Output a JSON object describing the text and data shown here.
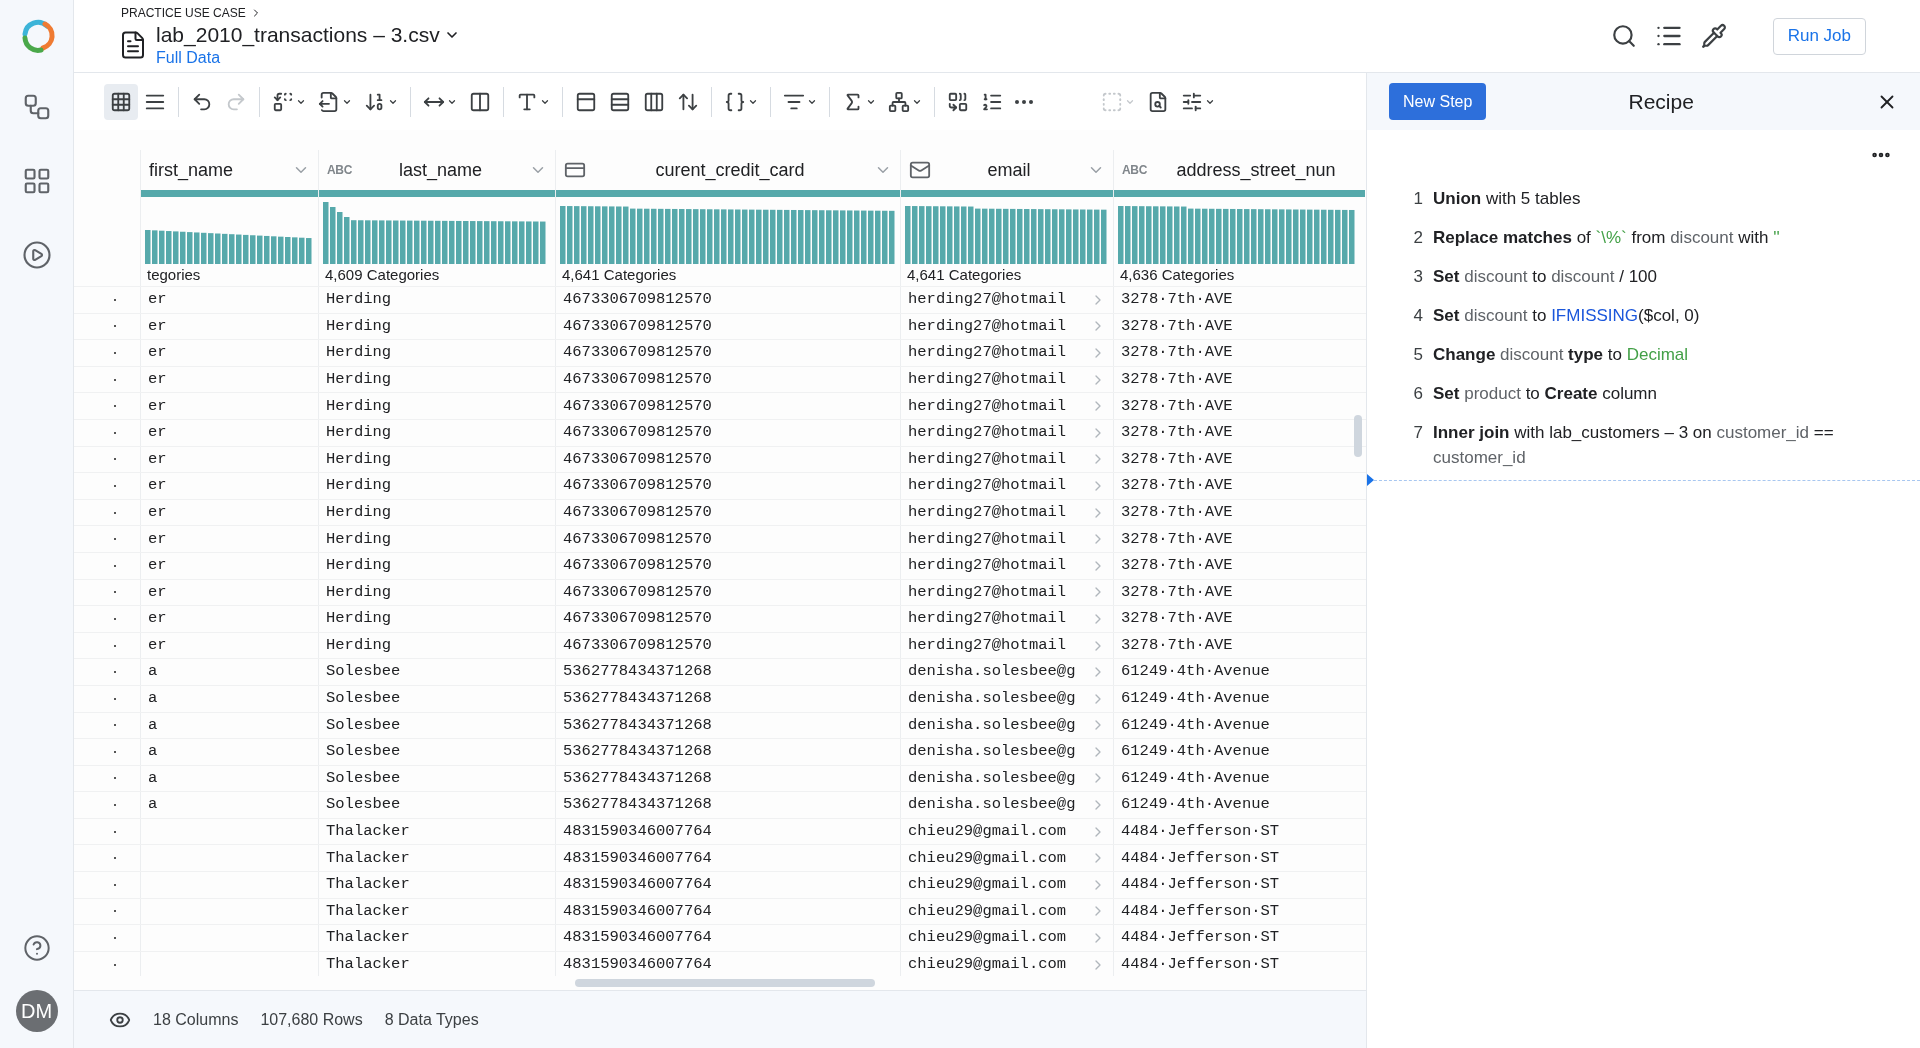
{
  "header": {
    "breadcrumb": "PRACTICE USE CASE",
    "title": "lab_2010_transactions – 3.csv",
    "subtitle": "Full Data",
    "run_button": "Run Job"
  },
  "toolbar": {
    "view_toggle": [
      {
        "selected": true
      },
      {
        "selected": false
      }
    ],
    "history": [
      {
        "disabled": false
      },
      {
        "disabled": true
      }
    ]
  },
  "columns": [
    {
      "name": "first_name",
      "kind": "none",
      "categories": "tegories",
      "level": 1,
      "dropdown": true
    },
    {
      "name": "last_name",
      "kind": "string",
      "type_label": "ABC",
      "categories": "4,609 Categories",
      "level": 1,
      "dropdown": true
    },
    {
      "name": "curent_credit_card",
      "kind": "card",
      "categories": "4,641 Categories",
      "level": 1,
      "dropdown": true
    },
    {
      "name": "email",
      "kind": "email",
      "categories": "4,641 Categories",
      "level": 1,
      "dropdown": true
    },
    {
      "name": "address_street_nun",
      "kind": "string",
      "type_label": "ABC",
      "categories": "4,636 Categories",
      "level": 1,
      "dropdown": false
    }
  ],
  "rows": [
    {
      "cells": [
        "er",
        "Herding",
        "4673306709812570",
        "herding27@hotmail",
        "3278·7th·AVE"
      ]
    },
    {
      "cells": [
        "er",
        "Herding",
        "4673306709812570",
        "herding27@hotmail",
        "3278·7th·AVE"
      ]
    },
    {
      "cells": [
        "er",
        "Herding",
        "4673306709812570",
        "herding27@hotmail",
        "3278·7th·AVE"
      ]
    },
    {
      "cells": [
        "er",
        "Herding",
        "4673306709812570",
        "herding27@hotmail",
        "3278·7th·AVE"
      ]
    },
    {
      "cells": [
        "er",
        "Herding",
        "4673306709812570",
        "herding27@hotmail",
        "3278·7th·AVE"
      ]
    },
    {
      "cells": [
        "er",
        "Herding",
        "4673306709812570",
        "herding27@hotmail",
        "3278·7th·AVE"
      ]
    },
    {
      "cells": [
        "er",
        "Herding",
        "4673306709812570",
        "herding27@hotmail",
        "3278·7th·AVE"
      ]
    },
    {
      "cells": [
        "er",
        "Herding",
        "4673306709812570",
        "herding27@hotmail",
        "3278·7th·AVE"
      ]
    },
    {
      "cells": [
        "er",
        "Herding",
        "4673306709812570",
        "herding27@hotmail",
        "3278·7th·AVE"
      ]
    },
    {
      "cells": [
        "er",
        "Herding",
        "4673306709812570",
        "herding27@hotmail",
        "3278·7th·AVE"
      ]
    },
    {
      "cells": [
        "er",
        "Herding",
        "4673306709812570",
        "herding27@hotmail",
        "3278·7th·AVE"
      ]
    },
    {
      "cells": [
        "er",
        "Herding",
        "4673306709812570",
        "herding27@hotmail",
        "3278·7th·AVE"
      ]
    },
    {
      "cells": [
        "er",
        "Herding",
        "4673306709812570",
        "herding27@hotmail",
        "3278·7th·AVE"
      ]
    },
    {
      "cells": [
        "er",
        "Herding",
        "4673306709812570",
        "herding27@hotmail",
        "3278·7th·AVE"
      ]
    },
    {
      "cells": [
        "a",
        "Solesbee",
        "5362778434371268",
        "denisha.solesbee@g",
        "61249·4th·Avenue"
      ]
    },
    {
      "cells": [
        "a",
        "Solesbee",
        "5362778434371268",
        "denisha.solesbee@g",
        "61249·4th·Avenue"
      ]
    },
    {
      "cells": [
        "a",
        "Solesbee",
        "5362778434371268",
        "denisha.solesbee@g",
        "61249·4th·Avenue"
      ]
    },
    {
      "cells": [
        "a",
        "Solesbee",
        "5362778434371268",
        "denisha.solesbee@g",
        "61249·4th·Avenue"
      ]
    },
    {
      "cells": [
        "a",
        "Solesbee",
        "5362778434371268",
        "denisha.solesbee@g",
        "61249·4th·Avenue"
      ]
    },
    {
      "cells": [
        "a",
        "Solesbee",
        "5362778434371268",
        "denisha.solesbee@g",
        "61249·4th·Avenue"
      ]
    },
    {
      "cells": [
        "",
        "Thalacker",
        "4831590346007764",
        "chieu29@gmail.com",
        "4484·Jefferson·ST"
      ]
    },
    {
      "cells": [
        "",
        "Thalacker",
        "4831590346007764",
        "chieu29@gmail.com",
        "4484·Jefferson·ST"
      ]
    },
    {
      "cells": [
        "",
        "Thalacker",
        "4831590346007764",
        "chieu29@gmail.com",
        "4484·Jefferson·ST"
      ]
    },
    {
      "cells": [
        "",
        "Thalacker",
        "4831590346007764",
        "chieu29@gmail.com",
        "4484·Jefferson·ST"
      ]
    },
    {
      "cells": [
        "",
        "Thalacker",
        "4831590346007764",
        "chieu29@gmail.com",
        "4484·Jefferson·ST"
      ]
    },
    {
      "cells": [
        "",
        "Thalacker",
        "4831590346007764",
        "chieu29@gmail.com",
        "4484·Jefferson·ST"
      ]
    }
  ],
  "status_bar": {
    "columns": "18 Columns",
    "rows": "107,680 Rows",
    "types": "8 Data Types"
  },
  "recipe": {
    "new_step": "New Step",
    "title": "Recipe",
    "steps": [
      {
        "number": "1",
        "parts": [
          {
            "kind": "bold",
            "text": "Union"
          },
          {
            "kind": "plain",
            "text": " with 5 tables"
          }
        ]
      },
      {
        "number": "2",
        "parts": [
          {
            "kind": "bold",
            "text": "Replace matches"
          },
          {
            "kind": "plain",
            "text": " of "
          },
          {
            "kind": "literal",
            "text": "`\\%`"
          },
          {
            "kind": "plain",
            "text": " from "
          },
          {
            "kind": "column",
            "text": "discount"
          },
          {
            "kind": "plain",
            "text": " with "
          },
          {
            "kind": "literal",
            "text": "''"
          }
        ]
      },
      {
        "number": "3",
        "parts": [
          {
            "kind": "bold",
            "text": "Set"
          },
          {
            "kind": "column",
            "text": " discount"
          },
          {
            "kind": "plain",
            "text": " to "
          },
          {
            "kind": "column",
            "text": "discount"
          },
          {
            "kind": "plain",
            "text": " / 100"
          }
        ]
      },
      {
        "number": "4",
        "parts": [
          {
            "kind": "bold",
            "text": "Set"
          },
          {
            "kind": "column",
            "text": " discount"
          },
          {
            "kind": "plain",
            "text": " to "
          },
          {
            "kind": "function",
            "text": "IFMISSING"
          },
          {
            "kind": "plain",
            "text": "($col, 0)"
          }
        ]
      },
      {
        "number": "5",
        "parts": [
          {
            "kind": "bold",
            "text": "Change"
          },
          {
            "kind": "column",
            "text": " discount"
          },
          {
            "kind": "bold",
            "text": " type"
          },
          {
            "kind": "plain",
            "text": " to "
          },
          {
            "kind": "literal",
            "text": "Decimal"
          }
        ]
      },
      {
        "number": "6",
        "parts": [
          {
            "kind": "bold",
            "text": "Set"
          },
          {
            "kind": "column",
            "text": " product"
          },
          {
            "kind": "plain",
            "text": " to "
          },
          {
            "kind": "bold",
            "text": "Create"
          },
          {
            "kind": "plain",
            "text": " column"
          }
        ]
      },
      {
        "number": "7",
        "parts": [
          {
            "kind": "bold",
            "text": "Inner join"
          },
          {
            "kind": "plain",
            "text": " with lab_customers – 3 on "
          },
          {
            "kind": "column",
            "text": "customer_id"
          },
          {
            "kind": "plain",
            "text": " == "
          },
          {
            "kind": "column",
            "text": "customer_id"
          }
        ]
      }
    ]
  },
  "user": {
    "initials": "DM"
  }
}
